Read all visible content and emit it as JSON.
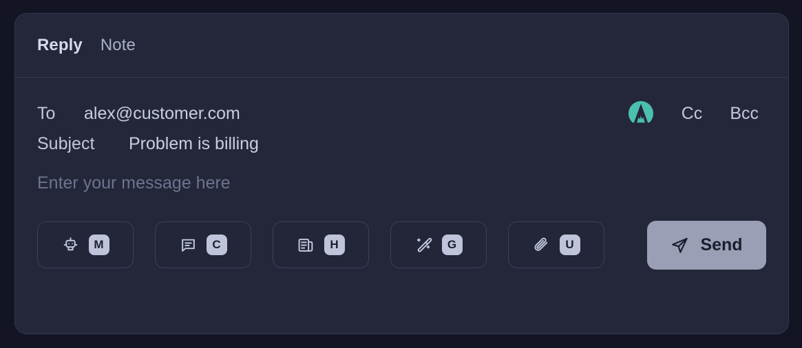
{
  "card": {
    "tabs": [
      {
        "label": "Reply",
        "name": "tab-reply",
        "active": true
      },
      {
        "label": "Note",
        "name": "tab-note",
        "active": false
      }
    ]
  },
  "fields": {
    "to_label": "To",
    "to_value": "alex@customer.com",
    "to_placeholder": "Recipient email",
    "subject_label": "Subject",
    "subject_value": "Problem is billing",
    "subject_placeholder": "Subject",
    "cc_label": "Cc",
    "bcc_label": "Bcc",
    "avatar_icon": "mountain-logo-icon",
    "avatar_color": "#4bbfb0"
  },
  "message": {
    "value": "",
    "placeholder": "Enter your message here"
  },
  "toolbar": {
    "buttons": [
      {
        "icon": "robot-icon",
        "key": "M",
        "name": "macro-button"
      },
      {
        "icon": "chat-bubble-icon",
        "key": "C",
        "name": "canned-response-button"
      },
      {
        "icon": "article-icon",
        "key": "H",
        "name": "help-article-button"
      },
      {
        "icon": "magic-wand-icon",
        "key": "G",
        "name": "ai-generate-button"
      },
      {
        "icon": "paperclip-icon",
        "key": "U",
        "name": "attach-file-button"
      }
    ],
    "send_label": "Send",
    "send_icon": "paper-plane-icon",
    "send_color": "#9b9fb6"
  },
  "theme": {
    "page_background": "#131525",
    "card_background": "#242739",
    "card_border": "#343850",
    "text_primary": "#d6d9ea",
    "text_muted": "#6d7490",
    "accent": "#4bbfb0"
  }
}
